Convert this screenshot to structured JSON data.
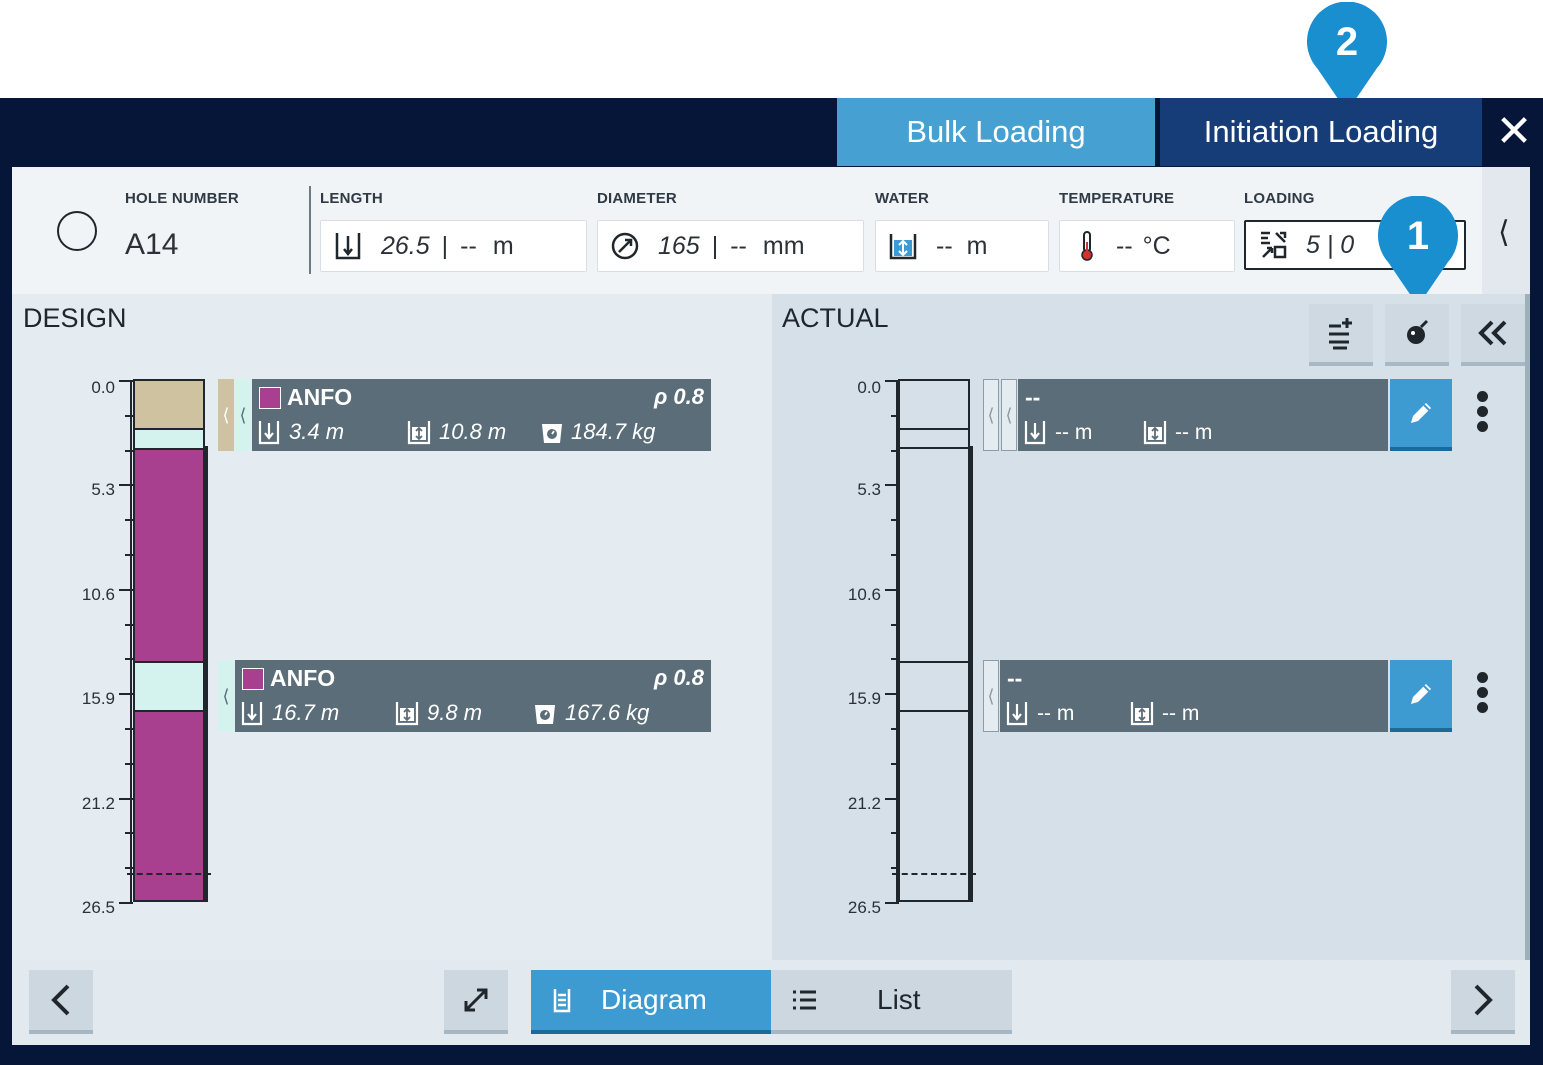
{
  "tabs": {
    "bulk": "Bulk Loading",
    "initiation": "Initiation Loading",
    "close": "✕"
  },
  "hole": {
    "label": "HOLE NUMBER",
    "value": "A14",
    "length": {
      "label": "LENGTH",
      "value": "26.5",
      "actual": "--",
      "unit": "m"
    },
    "diameter": {
      "label": "DIAMETER",
      "value": "165",
      "actual": "--",
      "unit": "mm"
    },
    "water": {
      "label": "WATER",
      "value": "--",
      "unit": "m"
    },
    "temperature": {
      "label": "TEMPERATURE",
      "value": "--",
      "unit": "°C"
    },
    "loading": {
      "label": "LOADING",
      "value": "5 | 0"
    }
  },
  "design": {
    "title": "DESIGN",
    "ticks": [
      "0.0",
      "5.3",
      "10.6",
      "15.9",
      "21.2",
      "26.5"
    ],
    "decks": [
      {
        "name": "ANFO",
        "density": "ρ 0.8",
        "length": "3.4 m",
        "water": "10.8 m",
        "mass": "184.7 kg"
      },
      {
        "name": "ANFO",
        "density": "ρ 0.8",
        "length": "16.7 m",
        "water": "9.8 m",
        "mass": "167.6 kg"
      }
    ]
  },
  "actual": {
    "title": "ACTUAL",
    "ticks": [
      "0.0",
      "5.3",
      "10.6",
      "15.9",
      "21.2",
      "26.5"
    ],
    "decks": [
      {
        "name": "--",
        "length": "-- m",
        "water": "-- m"
      },
      {
        "name": "--",
        "length": "-- m",
        "water": "-- m"
      }
    ]
  },
  "view_toggle": {
    "diagram": "Diagram",
    "list": "List",
    "selected": "Diagram"
  },
  "callouts": [
    "1",
    "2"
  ],
  "colors": {
    "accent": "#46a0d2",
    "navy": "#051639",
    "anfo": "#a8408f",
    "stemming": "#cfc2a0",
    "air": "#d4f3ee"
  }
}
